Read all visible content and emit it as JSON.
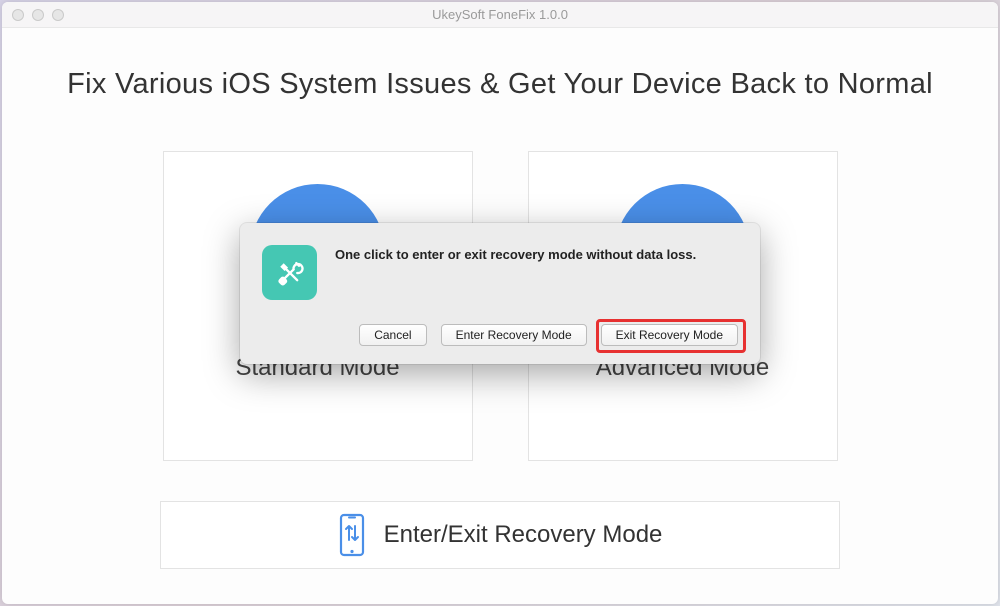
{
  "window": {
    "title": "UkeySoft FoneFix 1.0.0"
  },
  "main": {
    "title": "Fix Various iOS System Issues & Get Your Device Back to Normal",
    "cards": {
      "standard": {
        "label": "Standard Mode"
      },
      "advanced": {
        "label": "Advanced Mode"
      }
    },
    "bottom": {
      "label": "Enter/Exit Recovery Mode"
    }
  },
  "dialog": {
    "message": "One click to enter or exit recovery mode without data loss.",
    "buttons": {
      "cancel": "Cancel",
      "enter": "Enter Recovery Mode",
      "exit": "Exit Recovery Mode"
    },
    "icon_name": "tools-icon"
  },
  "colors": {
    "accent_blue": "#4a8fe8",
    "teal": "#45c7b3",
    "highlight": "#e73131"
  }
}
